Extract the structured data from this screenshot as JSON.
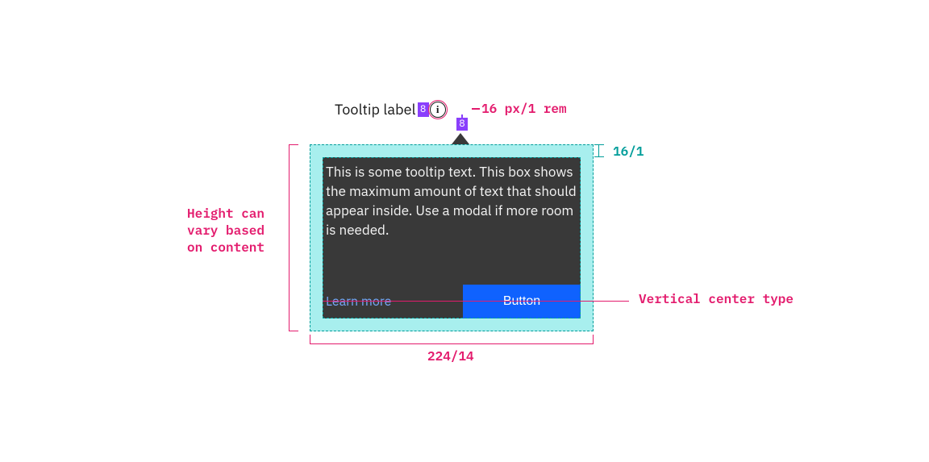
{
  "colors": {
    "spec_pink": "#e31b6d",
    "spec_teal": "#009d9a",
    "spec_purple": "#8a3ffc",
    "tooltip_bg": "#393939",
    "tooltip_text": "#f4f4f4",
    "link": "#78a9ff",
    "button_bg": "#0f62fe"
  },
  "trigger": {
    "label": "Tooltip label",
    "gap_h_px": "8",
    "gap_v_px": "8",
    "icon_name": "information-icon",
    "icon_size_label": "16 px/1 rem"
  },
  "tooltip": {
    "body": "This is some tooltip text. This box shows the maximum amount of text that should appear inside. Use a modal if more room is needed.",
    "link_label": "Learn more",
    "button_label": "Button"
  },
  "annotations": {
    "padding_top": "16/1",
    "width": "224/14",
    "height_note": "Height can vary based on content",
    "vcenter_note": "Vertical center type"
  }
}
